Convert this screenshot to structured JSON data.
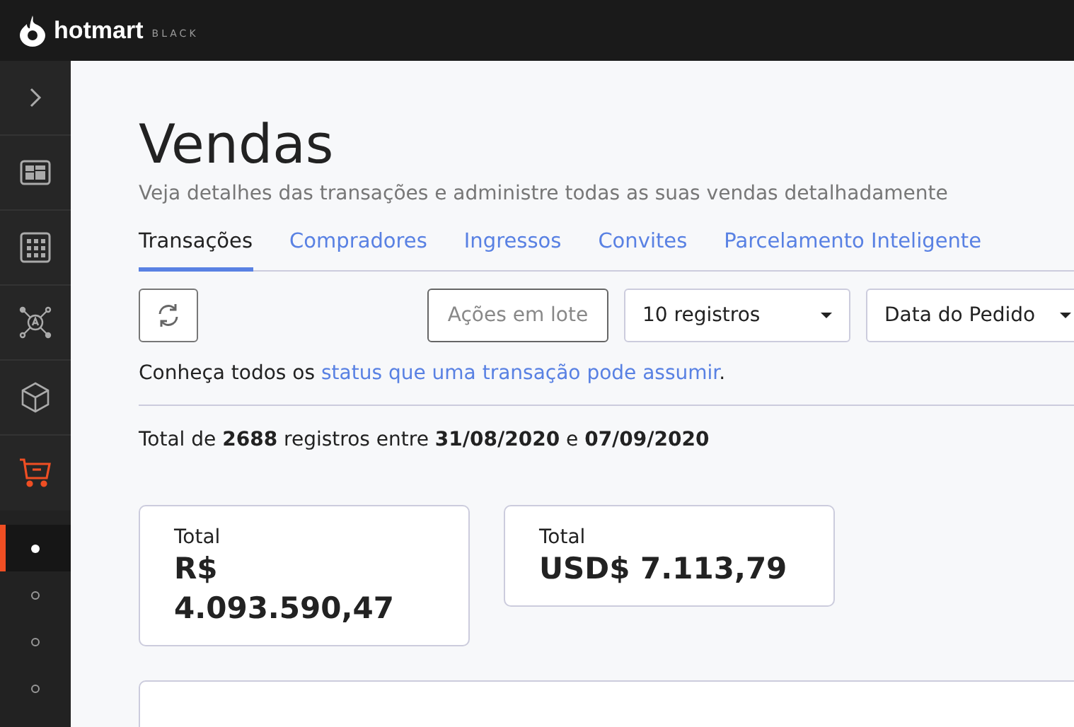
{
  "brand": {
    "name": "hotmart",
    "edition": "BLACK"
  },
  "sidebar": {
    "items": [
      {
        "kind": "expand",
        "selected": false
      },
      {
        "kind": "dashboard",
        "selected": false
      },
      {
        "kind": "apps",
        "selected": false
      },
      {
        "kind": "network",
        "selected": false
      },
      {
        "kind": "product",
        "selected": false
      },
      {
        "kind": "cart",
        "selected": true
      }
    ],
    "subitems": [
      {
        "selected": true
      },
      {
        "selected": false
      },
      {
        "selected": false
      },
      {
        "selected": false
      }
    ]
  },
  "page": {
    "title": "Vendas",
    "subtitle": "Veja detalhes das transações e administre todas as suas vendas detalhadamente"
  },
  "tabs": [
    {
      "label": "Transações",
      "selected": true
    },
    {
      "label": "Compradores",
      "selected": false
    },
    {
      "label": "Ingressos",
      "selected": false
    },
    {
      "label": "Convites",
      "selected": false
    },
    {
      "label": "Parcelamento Inteligente",
      "selected": false
    }
  ],
  "toolbar": {
    "bulk_actions": "Ações em lote",
    "page_size": "10 registros",
    "sort_by": "Data do Pedido"
  },
  "info": {
    "before": "Conheça todos os",
    "link": "status que uma transação pode assumir",
    "after": "."
  },
  "summary": "Total de **2688** registros entre **31/08/2020** e **07/09/2020**",
  "totals": [
    {
      "label": "Total",
      "currency": "R$",
      "value": "4.093.590,47"
    },
    {
      "label": "Total",
      "currency": "USD$",
      "value": "7.113,79"
    }
  ]
}
